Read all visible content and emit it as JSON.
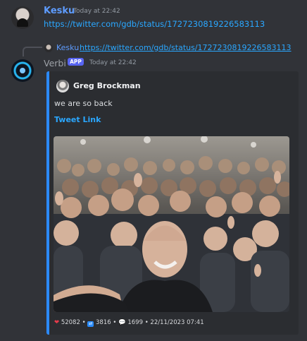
{
  "message1": {
    "author": "Kesku",
    "timestamp": "Today at 22:42",
    "link": "https://twitter.com/gdb/status/1727230819226583113"
  },
  "reply": {
    "author": "Kesku",
    "link": "https://twitter.com/gdb/status/1727230819226583113"
  },
  "bot_message": {
    "author": "Verbi",
    "badge": "APP",
    "timestamp": "Today at 22:42",
    "embed": {
      "author": "Greg Brockman",
      "description": "we are so back",
      "link_label": "Tweet Link",
      "image_icon": "group-selfie-photo",
      "footer": {
        "likes": "52082",
        "retweets": "3816",
        "replies": "1699",
        "date": "22/11/2023 07:41",
        "separator": "•"
      }
    }
  },
  "colors": {
    "background": "#313338",
    "embed_bg": "#2b2d31",
    "embed_border": "#2b8aff",
    "link": "#2aa7ff",
    "author": "#5e9cff",
    "badge": "#5865f2"
  }
}
